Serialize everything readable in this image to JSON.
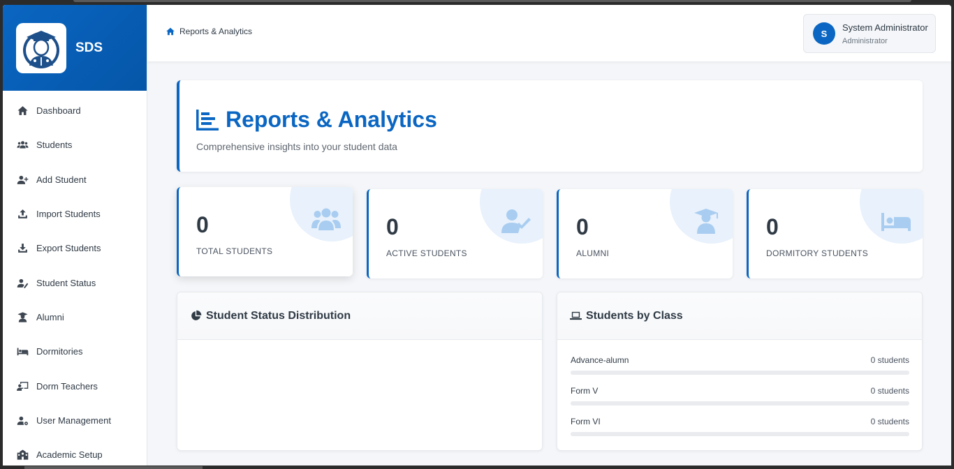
{
  "brand": {
    "name": "SDS"
  },
  "sidebar": {
    "items": [
      {
        "label": "Dashboard",
        "icon": "home-icon"
      },
      {
        "label": "Students",
        "icon": "users-icon"
      },
      {
        "label": "Add Student",
        "icon": "user-plus-icon"
      },
      {
        "label": "Import Students",
        "icon": "upload-icon"
      },
      {
        "label": "Export Students",
        "icon": "download-icon"
      },
      {
        "label": "Student Status",
        "icon": "user-edit-icon"
      },
      {
        "label": "Alumni",
        "icon": "graduate-icon"
      },
      {
        "label": "Dormitories",
        "icon": "bed-icon"
      },
      {
        "label": "Dorm Teachers",
        "icon": "chalkboard-teacher-icon"
      },
      {
        "label": "User Management",
        "icon": "user-cog-icon"
      },
      {
        "label": "Academic Setup",
        "icon": "school-icon"
      }
    ]
  },
  "header": {
    "breadcrumb": "Reports & Analytics",
    "user": {
      "initial": "S",
      "name": "System Administrator",
      "role": "Administrator"
    }
  },
  "page": {
    "title": "Reports & Analytics",
    "subtitle": "Comprehensive insights into your student data"
  },
  "stats": [
    {
      "value": "0",
      "label": "TOTAL STUDENTS",
      "icon": "users-icon"
    },
    {
      "value": "0",
      "label": "ACTIVE STUDENTS",
      "icon": "user-check-icon"
    },
    {
      "value": "0",
      "label": "ALUMNI",
      "icon": "graduate-icon"
    },
    {
      "value": "0",
      "label": "DORMITORY STUDENTS",
      "icon": "bed-icon"
    }
  ],
  "panels": {
    "status": {
      "title": "Student Status Distribution",
      "icon": "pie-chart-icon"
    },
    "classes": {
      "title": "Students by Class",
      "icon": "laptop-icon",
      "rows": [
        {
          "name": "Advance-alumn",
          "count": "0 students",
          "fraction": 0
        },
        {
          "name": "Form V",
          "count": "0 students",
          "fraction": 0
        },
        {
          "name": "Form VI",
          "count": "0 students",
          "fraction": 0
        }
      ]
    }
  },
  "colors": {
    "primary": "#0a66c2",
    "icon_soft": "#a9cdf0"
  }
}
